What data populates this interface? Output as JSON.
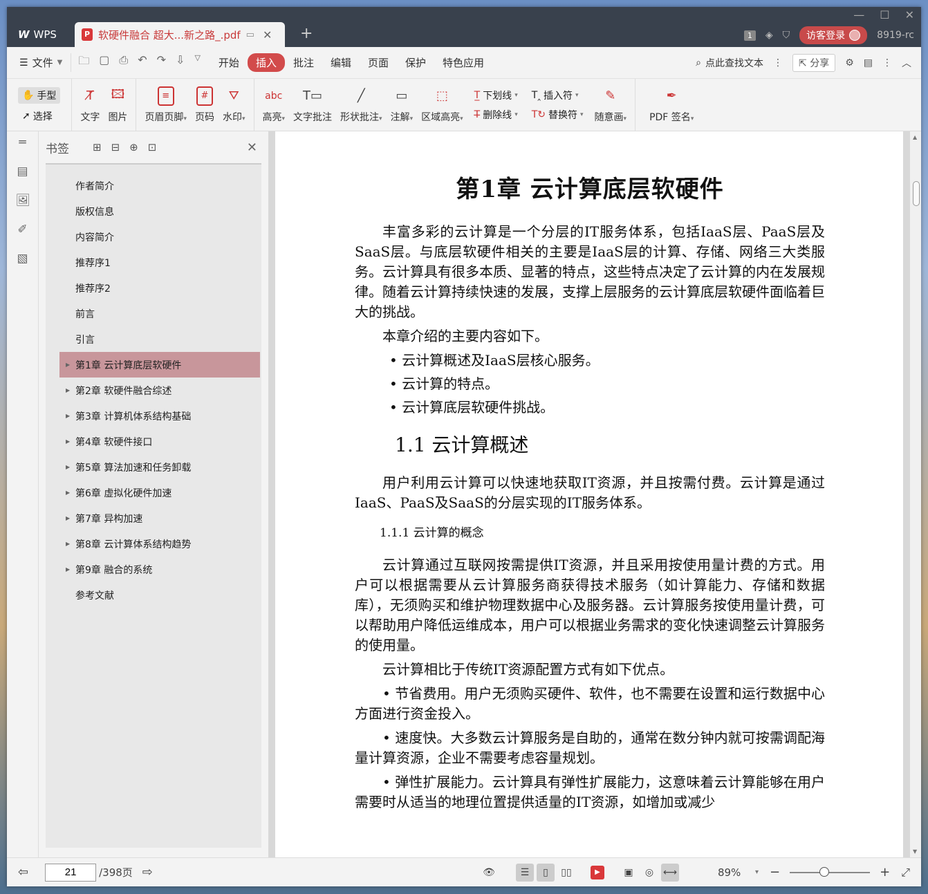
{
  "titlebar": {
    "wps_label": "WPS",
    "doc_tab_title": "软硬件融合 超大...新之路_.pdf",
    "badge": "1",
    "login_label": "访客登录",
    "user_id": "8919-rc"
  },
  "menu": {
    "file": "文件",
    "items": [
      "开始",
      "插入",
      "批注",
      "编辑",
      "页面",
      "保护",
      "特色应用"
    ],
    "active": "插入",
    "search_label": "点此查找文本",
    "share_label": "分享"
  },
  "ribbon": {
    "hand": "手型",
    "select": "选择",
    "text": "文字",
    "image": "图片",
    "header_footer": "页眉页脚",
    "page_number": "页码",
    "watermark": "水印",
    "highlight": "高亮",
    "text_comment": "文字批注",
    "shape_comment": "形状批注",
    "annotation": "注解",
    "area_highlight": "区域高亮",
    "underline": "下划线",
    "strikethrough": "删除线",
    "insert_mark": "插入符",
    "replace_mark": "替换符",
    "freehand": "随意画",
    "pdf_sign": "PDF 签名"
  },
  "bookmarks": {
    "title": "书签",
    "items": [
      {
        "label": "作者简介",
        "expandable": false
      },
      {
        "label": "版权信息",
        "expandable": false
      },
      {
        "label": "内容简介",
        "expandable": false
      },
      {
        "label": "推荐序1",
        "expandable": false
      },
      {
        "label": "推荐序2",
        "expandable": false
      },
      {
        "label": "前言",
        "expandable": false
      },
      {
        "label": "引言",
        "expandable": false
      },
      {
        "label": "第1章 云计算底层软硬件",
        "expandable": true,
        "selected": true
      },
      {
        "label": "第2章 软硬件融合综述",
        "expandable": true
      },
      {
        "label": "第3章 计算机体系结构基础",
        "expandable": true
      },
      {
        "label": "第4章 软硬件接口",
        "expandable": true
      },
      {
        "label": "第5章 算法加速和任务卸载",
        "expandable": true
      },
      {
        "label": "第6章 虚拟化硬件加速",
        "expandable": true
      },
      {
        "label": "第7章 异构加速",
        "expandable": true
      },
      {
        "label": "第8章 云计算体系结构趋势",
        "expandable": true
      },
      {
        "label": "第9章 融合的系统",
        "expandable": true
      },
      {
        "label": "参考文献",
        "expandable": false
      }
    ]
  },
  "page": {
    "chapter_title": "第1章  云计算底层软硬件",
    "p1": "丰富多彩的云计算是一个分层的IT服务体系，包括IaaS层、PaaS层及SaaS层。与底层软硬件相关的主要是IaaS层的计算、存储、网络三大类服务。云计算具有很多本质、显著的特点，这些特点决定了云计算的内在发展规律。随着云计算持续快速的发展，支撑上层服务的云计算底层软硬件面临着巨大的挑战。",
    "p2": "本章介绍的主要内容如下。",
    "b1": "• 云计算概述及IaaS层核心服务。",
    "b2": "• 云计算的特点。",
    "b3": "• 云计算底层软硬件挑战。",
    "sec1": "1.1  云计算概述",
    "p3": "用户利用云计算可以快速地获取IT资源，并且按需付费。云计算是通过IaaS、PaaS及SaaS的分层实现的IT服务体系。",
    "subsec1": "1.1.1  云计算的概念",
    "p4": "云计算通过互联网按需提供IT资源，并且采用按使用量计费的方式。用户可以根据需要从云计算服务商获得技术服务（如计算能力、存储和数据库），无须购买和维护物理数据中心及服务器。云计算服务按使用量计费，可以帮助用户降低运维成本，用户可以根据业务需求的变化快速调整云计算服务的使用量。",
    "p5": "云计算相比于传统IT资源配置方式有如下优点。",
    "p6": "• 节省费用。用户无须购买硬件、软件，也不需要在设置和运行数据中心方面进行资金投入。",
    "p7": "• 速度快。大多数云计算服务是自助的，通常在数分钟内就可按需调配海量计算资源，企业不需要考虑容量规划。",
    "p8": "• 弹性扩展能力。云计算具有弹性扩展能力，这意味着云计算能够在用户需要时从适当的地理位置提供适量的IT资源，如增加或减少"
  },
  "status": {
    "current_page": "21",
    "total_pages": "/398页",
    "zoom": "89%",
    "zoom_level": 0.43
  }
}
